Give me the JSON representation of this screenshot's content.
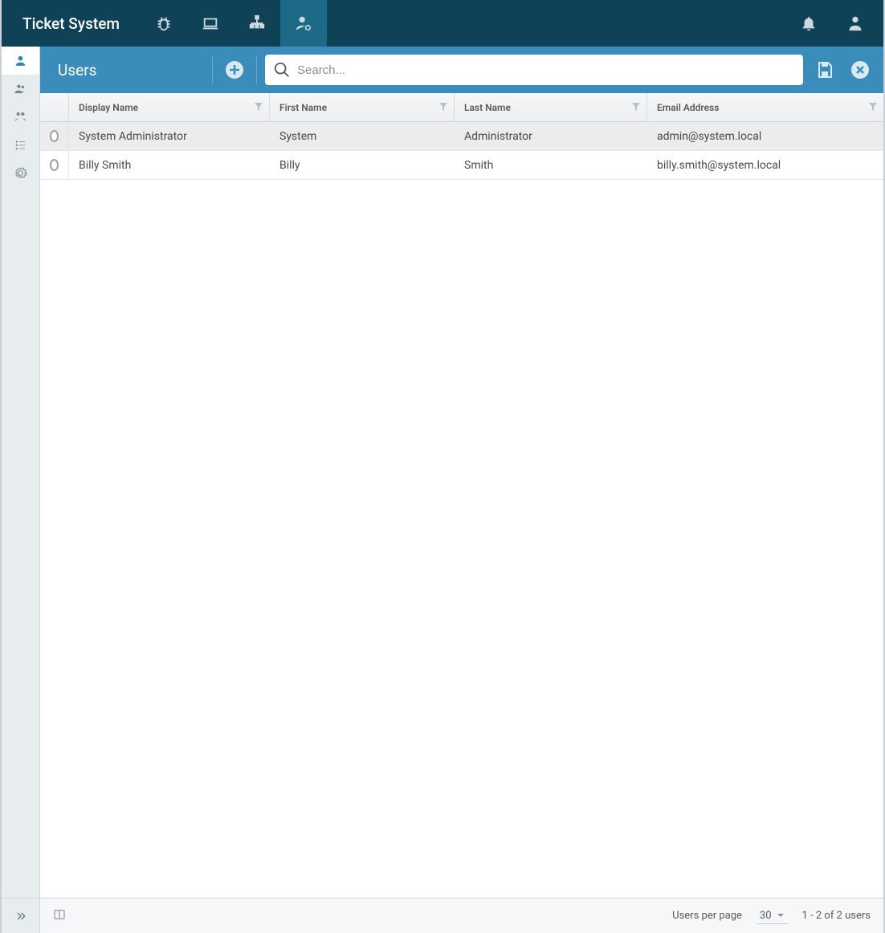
{
  "brand": "Ticket System",
  "topnav": {
    "items": [
      {
        "name": "bug"
      },
      {
        "name": "laptop"
      },
      {
        "name": "sitemap"
      },
      {
        "name": "user-settings",
        "active": true
      }
    ],
    "right": [
      {
        "name": "bell"
      },
      {
        "name": "user-menu"
      }
    ]
  },
  "sidebar": {
    "items": [
      {
        "name": "users",
        "active": true
      },
      {
        "name": "groups"
      },
      {
        "name": "roles"
      },
      {
        "name": "checklist"
      },
      {
        "name": "settings"
      }
    ]
  },
  "toolbar": {
    "title": "Users",
    "search_placeholder": "Search..."
  },
  "table": {
    "columns": {
      "display_name": "Display Name",
      "first_name": "First Name",
      "last_name": "Last Name",
      "email": "Email Address"
    },
    "rows": [
      {
        "selected": true,
        "display_name": "System Administrator",
        "first_name": "System",
        "last_name": "Administrator",
        "email": "admin@system.local"
      },
      {
        "selected": false,
        "display_name": "Billy Smith",
        "first_name": "Billy",
        "last_name": "Smith",
        "email": "billy.smith@system.local"
      }
    ]
  },
  "footer": {
    "per_page_label": "Users per page",
    "per_page_value": "30",
    "range": "1 - 2 of 2 users"
  }
}
